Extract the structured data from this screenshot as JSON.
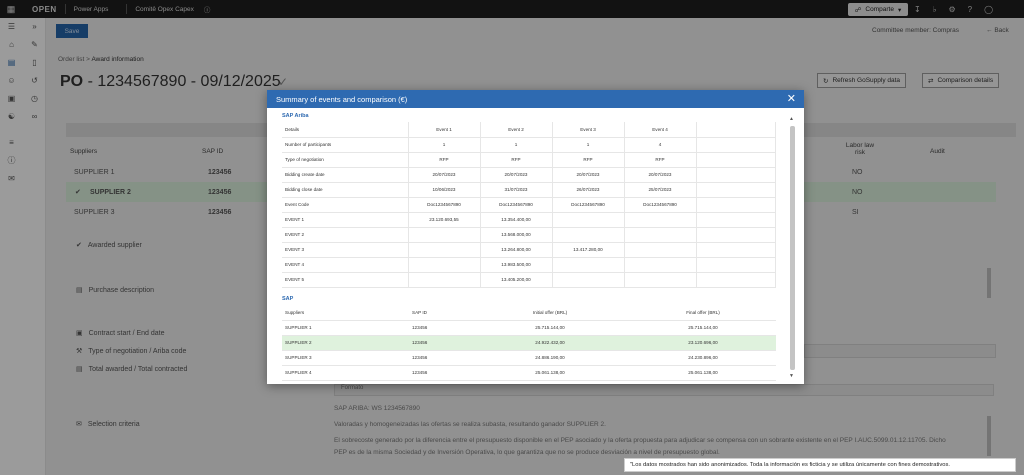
{
  "topbar": {
    "brand": "OPEN",
    "app": "Power Apps",
    "env": "Comitê Opex Capex",
    "share_label": "Comparte",
    "icons": [
      "waffle-icon",
      "settings-icon",
      "download-icon",
      "bell-icon",
      "gear-icon",
      "help-icon",
      "avatar-icon"
    ]
  },
  "header": {
    "save_label": "Save",
    "committee": "Committee member: Compras",
    "back_label": "Back",
    "breadcrumb_root": "Order list",
    "breadcrumb_current": "Award information",
    "po_prefix": "PO",
    "po_rest": "- 1234567890 -  09/12/2025",
    "refresh_label": "Refresh GoSupply data",
    "comparison_label": "Comparison details"
  },
  "bg_table": {
    "headers": {
      "suppliers": "Suppliers",
      "sap_id": "SAP ID",
      "labor": "Labor law risk",
      "audit": "Audit"
    },
    "rows": [
      {
        "name": "SUPPLIER 1",
        "sap": "123456",
        "labor": "NO",
        "highlight": false
      },
      {
        "name": "SUPPLIER 2",
        "sap": "123456",
        "labor": "NO",
        "highlight": true
      },
      {
        "name": "SUPPLIER 3",
        "sap": "123456",
        "labor": "SI",
        "highlight": false
      }
    ]
  },
  "bg_labels": {
    "awarded": "Awarded supplier",
    "purchase": "Purchase description",
    "contract": "Contract start / End date",
    "negotiation": "Type of negotiation / Ariba code",
    "total": "Total awarded / Total contracted",
    "criteria": "Selection criteria",
    "format": "Formato"
  },
  "editor": {
    "line1": "SAP ARIBA: WS 1234567890",
    "line2": "Valoradas y homogeneizadas las ofertas se realiza subasta, resultando ganador SUPPLIER 2.",
    "line3": "El sobrecoste generado por la diferencia entre el presupuesto disponible en el PEP asociado y la oferta propuesta para adjudicar se compensa con un sobrante existente en el PEP I.AUC.5099.01.12.11705. Dicho",
    "line4": "PEP es de la misma Sociedad y de Inversión Operativa, lo que garantiza que no se produce desviación a nivel de presupuesto global."
  },
  "modal": {
    "title": "Summary of events and comparison (€)",
    "ariba_label": "SAP Ariba",
    "details": {
      "headers": [
        "Details",
        "Event 1",
        "Event 2",
        "Event 3",
        "Event 4"
      ],
      "rows": [
        [
          "Number of participants",
          "1",
          "1",
          "1",
          "4"
        ],
        [
          "Type of negotiation",
          "RFP",
          "RFP",
          "RFP",
          "RFP"
        ],
        [
          "Bidding create date",
          "20/07/2023",
          "20/07/2023",
          "20/07/2023",
          "20/07/2023"
        ],
        [
          "Bidding close date",
          "10/06/2023",
          "31/07/2023",
          "26/07/2023",
          "25/07/2023"
        ],
        [
          "Event Code",
          "Doc1234567890",
          "Doc1234567890",
          "Doc1234567890",
          "Doc1234567890"
        ]
      ]
    },
    "events": [
      [
        "EVENT 1",
        "23.120.693,55",
        "13.354.400,00",
        "",
        ""
      ],
      [
        "EVENT 2",
        "",
        "13.568.000,00",
        "",
        ""
      ],
      [
        "EVENT 3",
        "",
        "13.264.800,00",
        "13.417.280,00",
        ""
      ],
      [
        "EVENT 4",
        "",
        "13.983.500,00",
        "",
        ""
      ],
      [
        "EVENT 5",
        "",
        "13.405.200,00",
        "",
        ""
      ]
    ],
    "sap_label": "SAP",
    "sap_table": {
      "headers": [
        "Suppliers",
        "SAP ID",
        "Initial offer (BRL)",
        "Final offer (BRL)"
      ],
      "rows": [
        {
          "cells": [
            "SUPPLIER 1",
            "123456",
            "25.715.144,00",
            "25.715.144,00"
          ],
          "highlight": false
        },
        {
          "cells": [
            "SUPPLIER 2",
            "123456",
            "24.922.432,00",
            "23.120.696,00"
          ],
          "highlight": true
        },
        {
          "cells": [
            "SUPPLIER 3",
            "123456",
            "24.886.190,00",
            "24.230.896,00"
          ],
          "highlight": false
        },
        {
          "cells": [
            "SUPPLIER 4",
            "123456",
            "25.061.138,00",
            "25.061.138,00"
          ],
          "highlight": false
        }
      ]
    }
  },
  "notice": "\"Los datos mostrados han sido anonimizados. Toda la información es ficticia y se utiliza únicamente con fines demostrativos."
}
